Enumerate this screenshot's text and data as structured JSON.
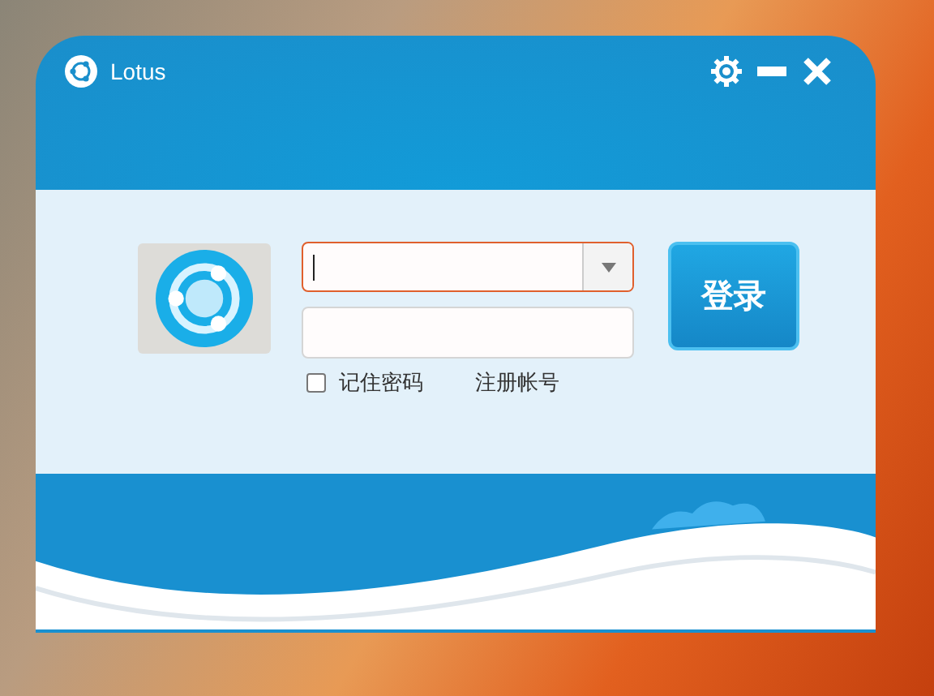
{
  "window": {
    "title": "Lotus"
  },
  "login": {
    "username": {
      "focused": true
    },
    "password": {
      "focused": false
    },
    "remember_password": {
      "label": "记住密码",
      "checked": false
    },
    "register_link": "注册帐号",
    "login_button": "登录"
  }
}
